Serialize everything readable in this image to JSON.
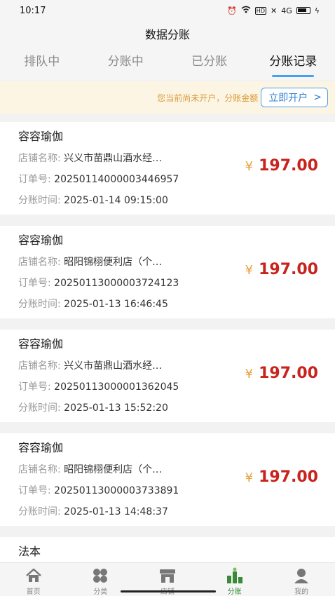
{
  "status_bar": {
    "time": "10:17",
    "hd_badge": "HD",
    "network": "4G"
  },
  "title": "数据分账",
  "tabs": [
    {
      "label": "排队中"
    },
    {
      "label": "分账中"
    },
    {
      "label": "已分账"
    },
    {
      "label": "分账记录",
      "active": true
    }
  ],
  "notice": {
    "text": "您当前尚未开户，分账金额",
    "button_label": "立即开户",
    "button_chevron": ">"
  },
  "labels": {
    "shop": "店铺名称:",
    "order": "订单号:",
    "time": "分账时间:",
    "currency": "¥"
  },
  "records": [
    {
      "name": "容容瑜伽",
      "shop": "兴义市苗鼎山酒水经…",
      "order": "20250114000003446957",
      "time": "2025-01-14 09:15:00",
      "amount": "197.00"
    },
    {
      "name": "容容瑜伽",
      "shop": "昭阳锦栩便利店（个…",
      "order": "20250113000003724123",
      "time": "2025-01-13 16:46:45",
      "amount": "197.00"
    },
    {
      "name": "容容瑜伽",
      "shop": "兴义市苗鼎山酒水经…",
      "order": "20250113000001362045",
      "time": "2025-01-13 15:52:20",
      "amount": "197.00"
    },
    {
      "name": "容容瑜伽",
      "shop": "昭阳锦栩便利店（个…",
      "order": "20250113000003733891",
      "time": "2025-01-13 14:48:37",
      "amount": "197.00"
    }
  ],
  "partial_record": {
    "name": "法本"
  },
  "bottom_nav": [
    {
      "label": "首页",
      "icon": "home-icon"
    },
    {
      "label": "分类",
      "icon": "category-icon"
    },
    {
      "label": "店铺",
      "icon": "shop-icon"
    },
    {
      "label": "分账",
      "icon": "split-account-icon",
      "active": true
    },
    {
      "label": "我的",
      "icon": "profile-icon"
    }
  ],
  "colors": {
    "accent": "#4aa0e8",
    "amount": "#c8231c",
    "notice_bg": "#fdf5e4",
    "nav_active": "#3a8a3a"
  }
}
